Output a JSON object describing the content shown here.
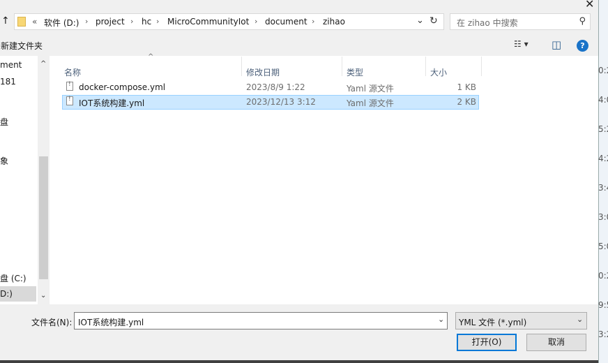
{
  "window": {
    "close_glyph": "✕"
  },
  "address": {
    "up_glyph": "↑",
    "overflow": "«",
    "crumbs": [
      "软件 (D:)",
      "project",
      "hc",
      "MicroCommunityIot",
      "document",
      "zihao"
    ],
    "sep": "›",
    "dropdown_glyph": "⌄",
    "refresh_glyph": "↻"
  },
  "search": {
    "placeholder": "在 zihao 中搜索",
    "icon": "search-icon"
  },
  "toolbar": {
    "new_folder": "新建文件夹",
    "view_glyph": "☷ ▾",
    "pane_glyph": "◫",
    "help_glyph": "?"
  },
  "columns": {
    "name": "名称",
    "modified": "修改日期",
    "type": "类型",
    "size": "大小"
  },
  "files": [
    {
      "name": "docker-compose.yml",
      "modified": "2023/8/9 1:22",
      "type": "Yaml 源文件",
      "size": "1 KB"
    },
    {
      "name": "IOT系统构建.yml",
      "modified": "2023/12/13 3:12",
      "type": "Yaml 源文件",
      "size": "2 KB"
    }
  ],
  "nav": {
    "items": [
      "ment",
      "181",
      "盘",
      "象",
      "盘 (C:)",
      "D:)"
    ],
    "scroll_up": "^",
    "scroll_down": "⌄"
  },
  "right_strip": [
    "0:2",
    "4:0",
    "5:2",
    "4:2",
    "3:4",
    "3:0",
    "5:0",
    "0:2",
    "9:5",
    "3:2"
  ],
  "bottom": {
    "filename_label": "文件名(N):",
    "filename_value": "IOT系统构建.yml",
    "filetype_value": "YML 文件 (*.yml)",
    "open_button": "打开(O)",
    "cancel_button": "取消"
  }
}
